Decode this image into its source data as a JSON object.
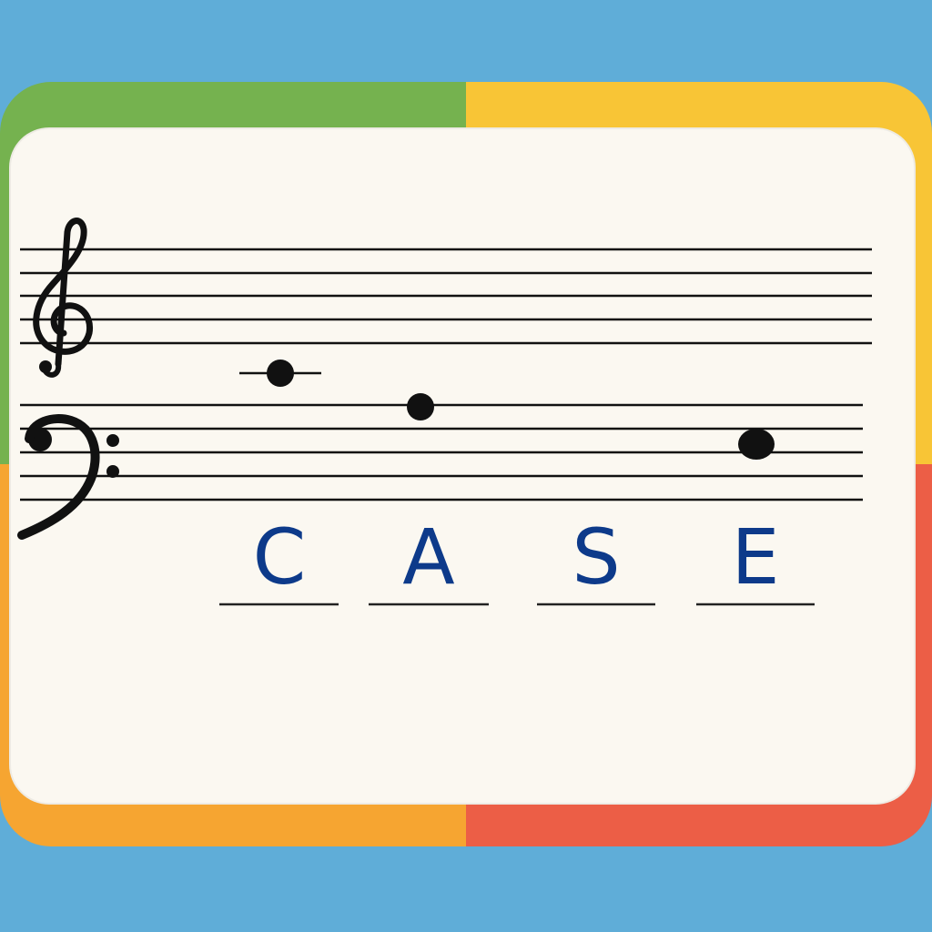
{
  "colors": {
    "background": "#5fadd8",
    "frame_top_left": "#75b24f",
    "frame_top_right": "#f8c536",
    "frame_bottom_left": "#f6a531",
    "frame_bottom_right": "#ec5e46",
    "card": "#fbf8f1",
    "ink": "#111111",
    "answer_ink": "#0d3a8a"
  },
  "treble_clef_icon": "treble-clef",
  "bass_clef_icon": "bass-clef",
  "answers": [
    {
      "letter": "C"
    },
    {
      "letter": "A"
    },
    {
      "letter": "S"
    },
    {
      "letter": "E"
    }
  ]
}
